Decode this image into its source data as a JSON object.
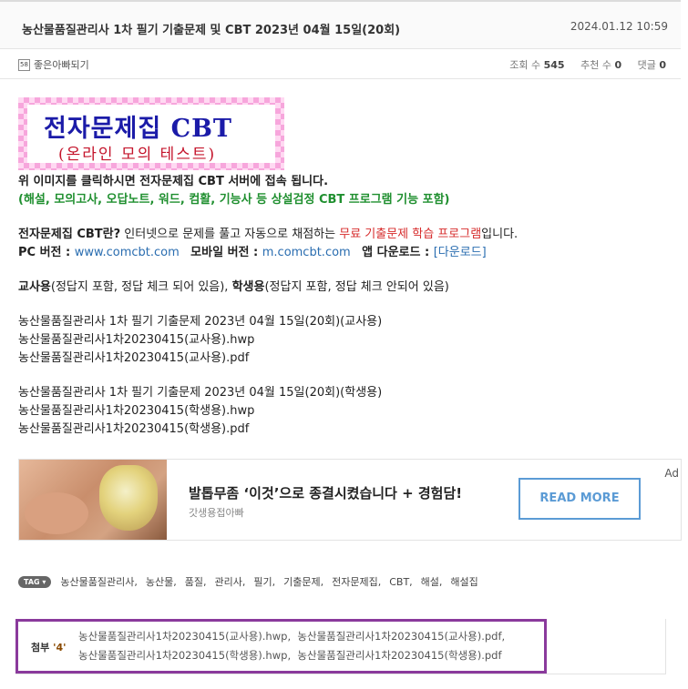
{
  "post": {
    "title": "농산물품질관리사 1차 필기 기출문제 및 CBT 2023년 04월 15일(20회)",
    "date": "2024.01.12 10:59"
  },
  "meta": {
    "blog_icon_text": "58",
    "blog_name": "좋은아빠되기",
    "views_label": "조회 수",
    "views": "545",
    "recommend_label": "추천 수",
    "recommend": "0",
    "comments_label": "댓글",
    "comments": "0"
  },
  "banner": {
    "title": "전자문제집 CBT",
    "subtitle": "(온라인 모의 테스트)"
  },
  "body": {
    "click_notice": "위 이미지를 클릭하시면 전자문제집 CBT 서버에 접속 됩니다.",
    "features": "(해설, 모의고사, 오답노트, 워드, 컴활, 기능사 등 상설검정 CBT 프로그램 기능 포함)",
    "intro_bold": "전자문제집 CBT란?",
    "intro_text": " 인터넷으로 문제를 풀고 자동으로 채점하는 ",
    "intro_red": "무료 기출문제 학습 프로그램",
    "intro_end": "입니다.",
    "pc_label": "PC 버전 : ",
    "pc_url": "www.comcbt.com",
    "mobile_label": "모바일 버전 : ",
    "mobile_url": "m.comcbt.com",
    "app_label": "앱 다운로드 : ",
    "app_link": "[다운로드]",
    "teacher_bold": "교사용",
    "teacher_text": "(정답지 포함, 정답 체크 되어 있음), ",
    "student_bold": "학생용",
    "student_text": "(정답지 포함, 정답 체크 안되어 있음)",
    "teacher_block": [
      "농산물품질관리사 1차 필기 기출문제 2023년 04월 15일(20회)(교사용)",
      "농산물품질관리사1차20230415(교사용).hwp",
      "농산물품질관리사1차20230415(교사용).pdf"
    ],
    "student_block": [
      "농산물품질관리사 1차 필기 기출문제 2023년 04월 15일(20회)(학생용)",
      "농산물품질관리사1차20230415(학생용).hwp",
      "농산물품질관리사1차20230415(학생용).pdf"
    ]
  },
  "ad": {
    "title": "발톱무좀 ‘이것’으로 종결시켰습니다 + 경험담!",
    "source": "갓생용접아빠",
    "button": "READ MORE",
    "mark": "Ad"
  },
  "tags": {
    "badge": "TAG ▾",
    "items": [
      "농산물품질관리사",
      "농산물",
      "품질",
      "관리사",
      "필기",
      "기출문제",
      "전자문제집",
      "CBT",
      "해설",
      "해설집"
    ]
  },
  "attachments": {
    "label": "첨부",
    "count": "'4'",
    "files": [
      "농산물품질관리사1차20230415(교사용).hwp",
      "농산물품질관리사1차20230415(교사용).pdf",
      "농산물품질관리사1차20230415(학생용).hwp",
      "농산물품질관리사1차20230415(학생용).pdf"
    ]
  },
  "colors": {
    "accent_green": "#1f8f2f",
    "accent_red": "#d62a2a",
    "link_blue": "#2a6db0",
    "attach_border": "#8a3a9c",
    "ad_button": "#5b9bd5"
  }
}
